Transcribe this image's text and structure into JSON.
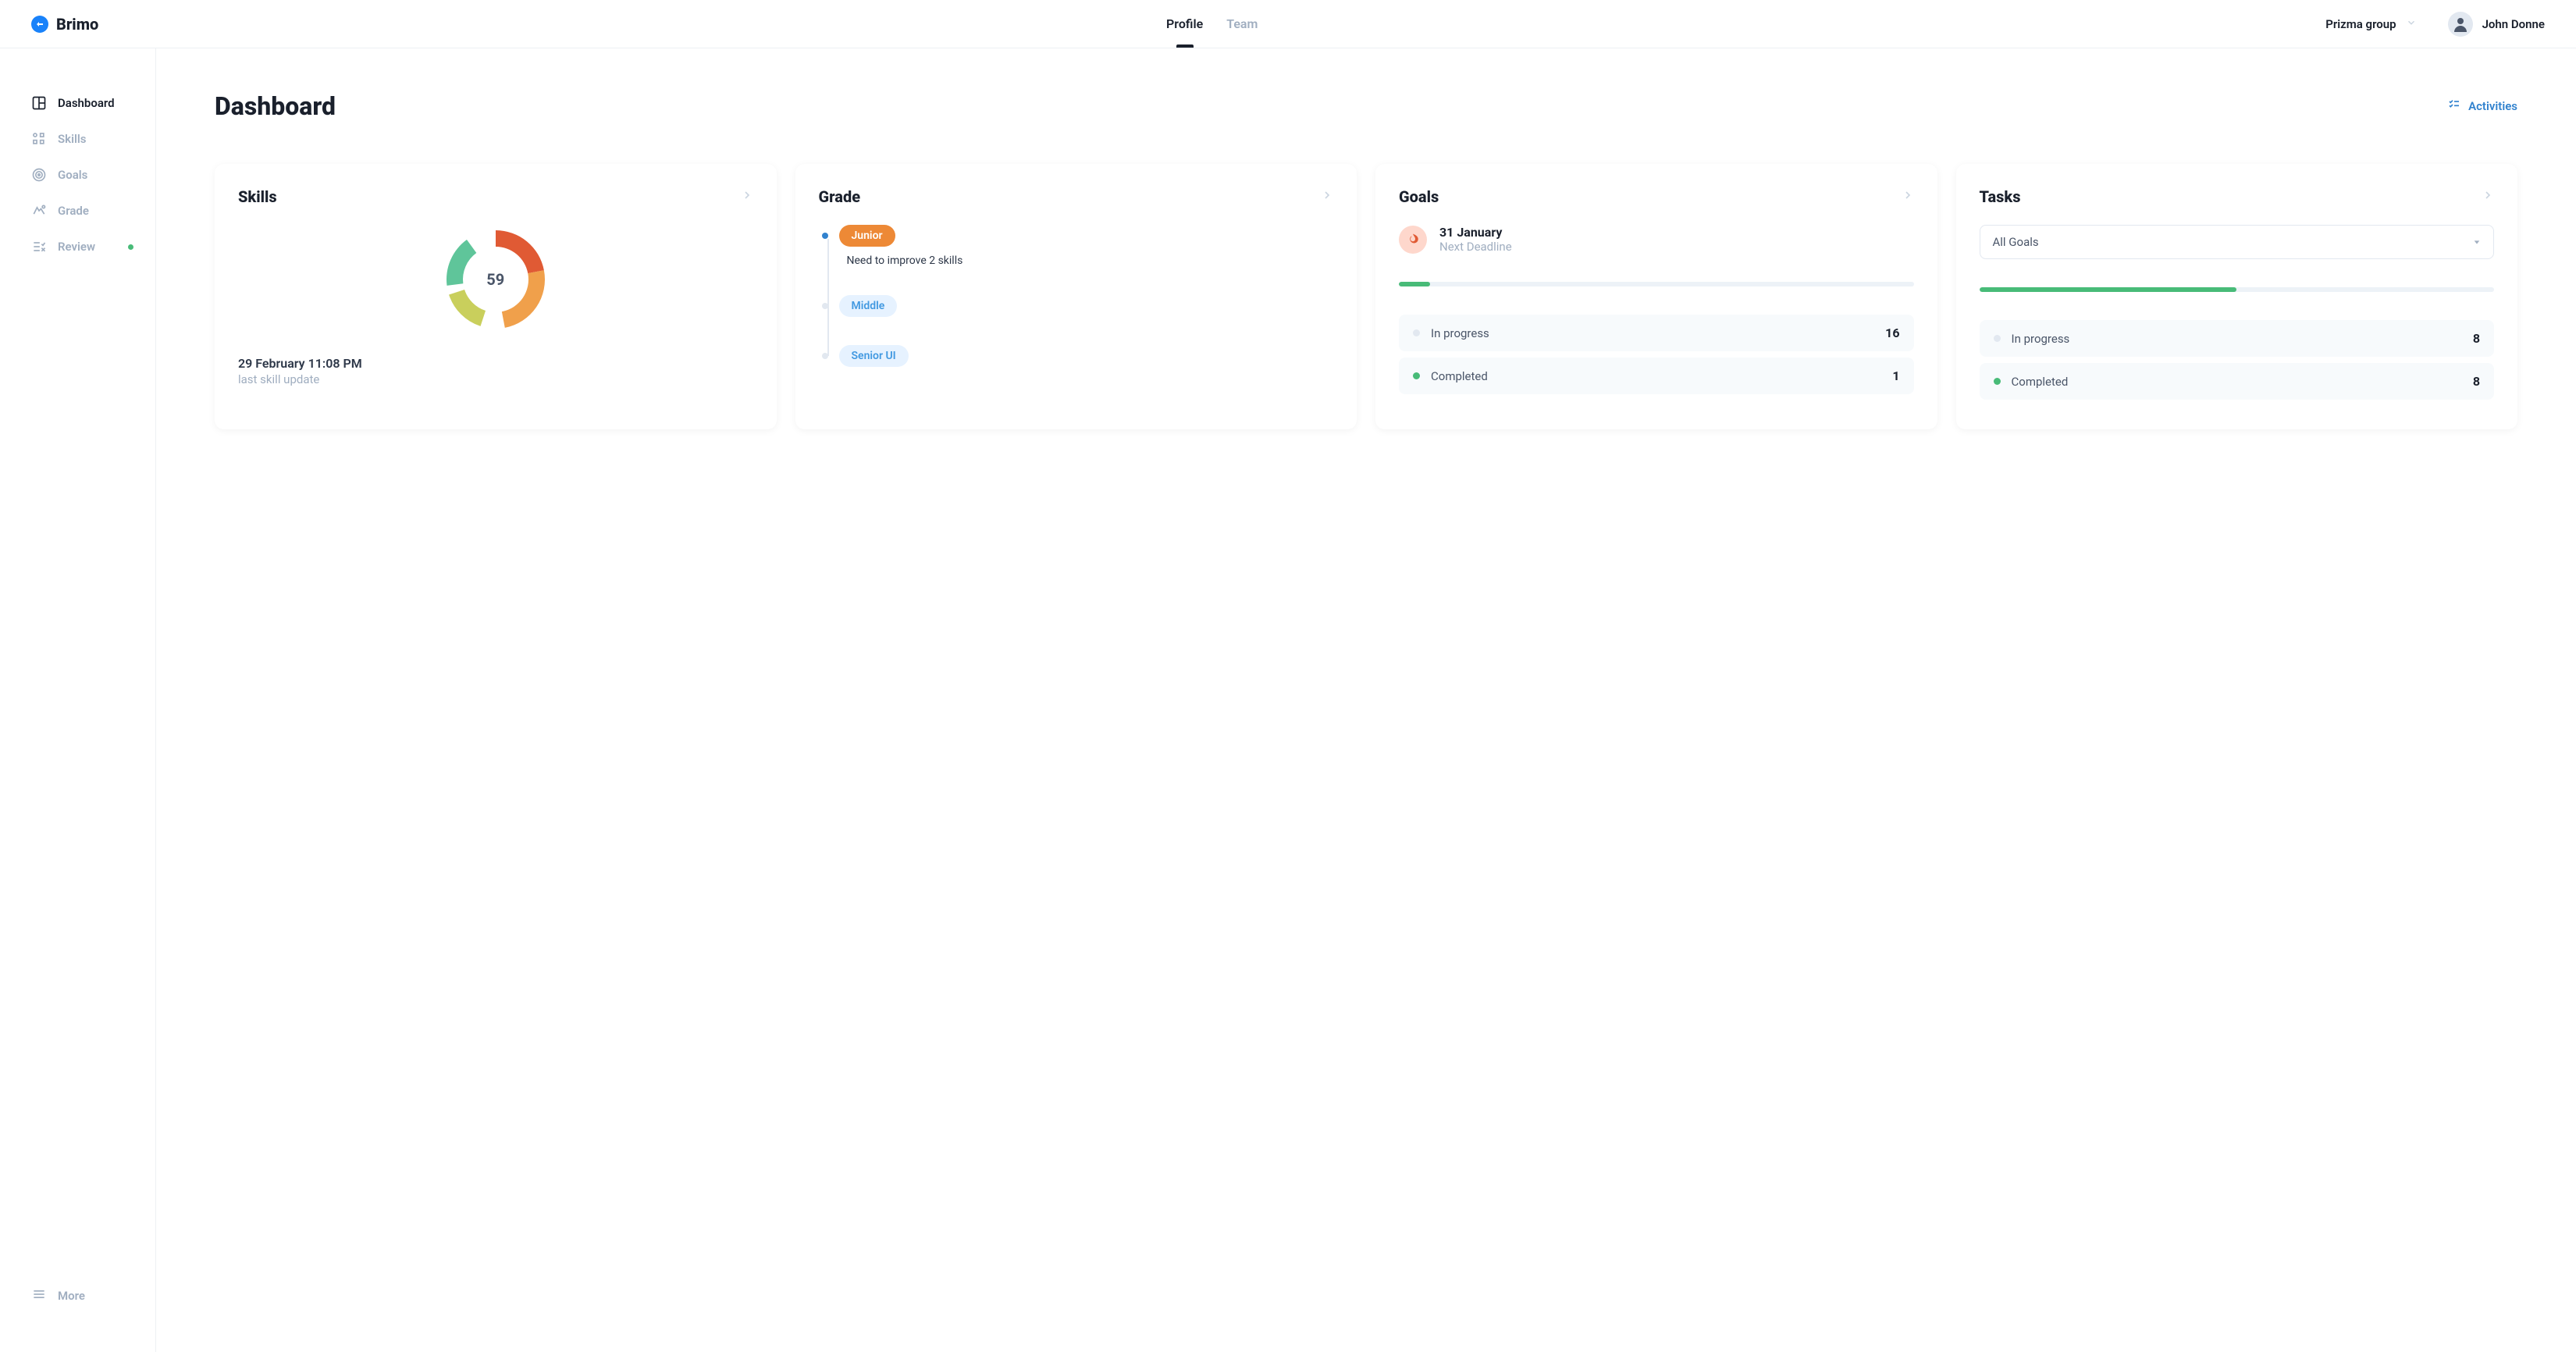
{
  "header": {
    "logo_text": "Brimo",
    "tabs": [
      {
        "label": "Profile",
        "active": true
      },
      {
        "label": "Team",
        "active": false
      }
    ],
    "group_label": "Prizma group",
    "user_name": "John Donne"
  },
  "sidebar": {
    "items": [
      {
        "label": "Dashboard",
        "icon": "dashboard",
        "active": true,
        "dot": false
      },
      {
        "label": "Skills",
        "icon": "skills",
        "active": false,
        "dot": false
      },
      {
        "label": "Goals",
        "icon": "goals",
        "active": false,
        "dot": false
      },
      {
        "label": "Grade",
        "icon": "grade",
        "active": false,
        "dot": false
      },
      {
        "label": "Review",
        "icon": "review",
        "active": false,
        "dot": true
      }
    ],
    "more_label": "More"
  },
  "main": {
    "title": "Dashboard",
    "activities_label": "Activities"
  },
  "cards": {
    "skills": {
      "title": "Skills",
      "center_value": "59",
      "date": "29 February 11:08 PM",
      "sub_label": "last skill update"
    },
    "grade": {
      "title": "Grade",
      "items": [
        {
          "label": "Junior",
          "active": true,
          "sub": "Need to improve 2 skills"
        },
        {
          "label": "Middle",
          "active": false,
          "sub": ""
        },
        {
          "label": "Senior UI",
          "active": false,
          "sub": ""
        }
      ]
    },
    "goals": {
      "title": "Goals",
      "deadline_date": "31 January",
      "deadline_label": "Next Deadline",
      "progress_percent": 6,
      "status": [
        {
          "label": "In progress",
          "count": "16",
          "color": "#e2e8f0"
        },
        {
          "label": "Completed",
          "count": "1",
          "color": "#48bb78"
        }
      ]
    },
    "tasks": {
      "title": "Tasks",
      "select_label": "All Goals",
      "progress_percent": 50,
      "status": [
        {
          "label": "In progress",
          "count": "8",
          "color": "#e2e8f0"
        },
        {
          "label": "Completed",
          "count": "8",
          "color": "#48bb78"
        }
      ]
    }
  },
  "chart_data": {
    "type": "pie",
    "title": "Skills",
    "center_value": 59,
    "series": [
      {
        "name": "segment-1",
        "value": 22,
        "color": "#e05a34"
      },
      {
        "name": "segment-2",
        "value": 25,
        "color": "#f0a04b"
      },
      {
        "name": "gap-1",
        "value": 8,
        "color": "transparent"
      },
      {
        "name": "segment-3",
        "value": 15,
        "color": "#c9cf5c"
      },
      {
        "name": "gap-2",
        "value": 3,
        "color": "transparent"
      },
      {
        "name": "segment-4",
        "value": 17,
        "color": "#5fc59a"
      },
      {
        "name": "gap-3",
        "value": 10,
        "color": "transparent"
      }
    ]
  }
}
